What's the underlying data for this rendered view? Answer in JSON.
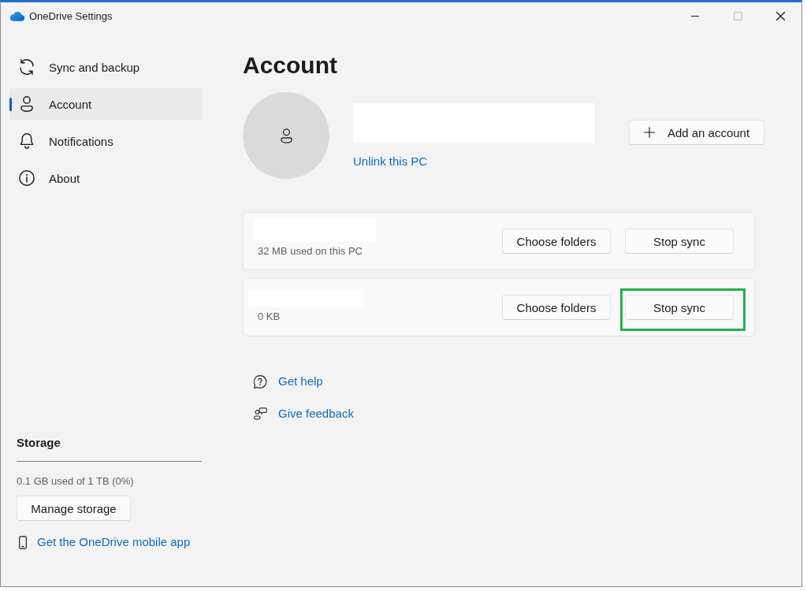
{
  "window": {
    "title": "OneDrive Settings",
    "maximize_disabled": true
  },
  "sidebar": {
    "items": [
      {
        "label": "Sync and backup",
        "selected": false
      },
      {
        "label": "Account",
        "selected": true
      },
      {
        "label": "Notifications",
        "selected": false
      },
      {
        "label": "About",
        "selected": false
      }
    ]
  },
  "storage": {
    "heading": "Storage",
    "usage": "0.1 GB used of 1 TB (0%)",
    "manage_button": "Manage storage",
    "mobile_app_link": "Get the OneDrive mobile app"
  },
  "account": {
    "heading": "Account",
    "unlink_link": "Unlink this PC",
    "add_account_button": "Add an account"
  },
  "folders": [
    {
      "usage": "32 MB used on this PC",
      "choose_button": "Choose folders",
      "stop_button": "Stop sync",
      "highlighted": false
    },
    {
      "usage": "0 KB",
      "choose_button": "Choose folders",
      "stop_button": "Stop sync",
      "highlighted": true
    }
  ],
  "help_links": [
    {
      "label": "Get help"
    },
    {
      "label": "Give feedback"
    }
  ]
}
